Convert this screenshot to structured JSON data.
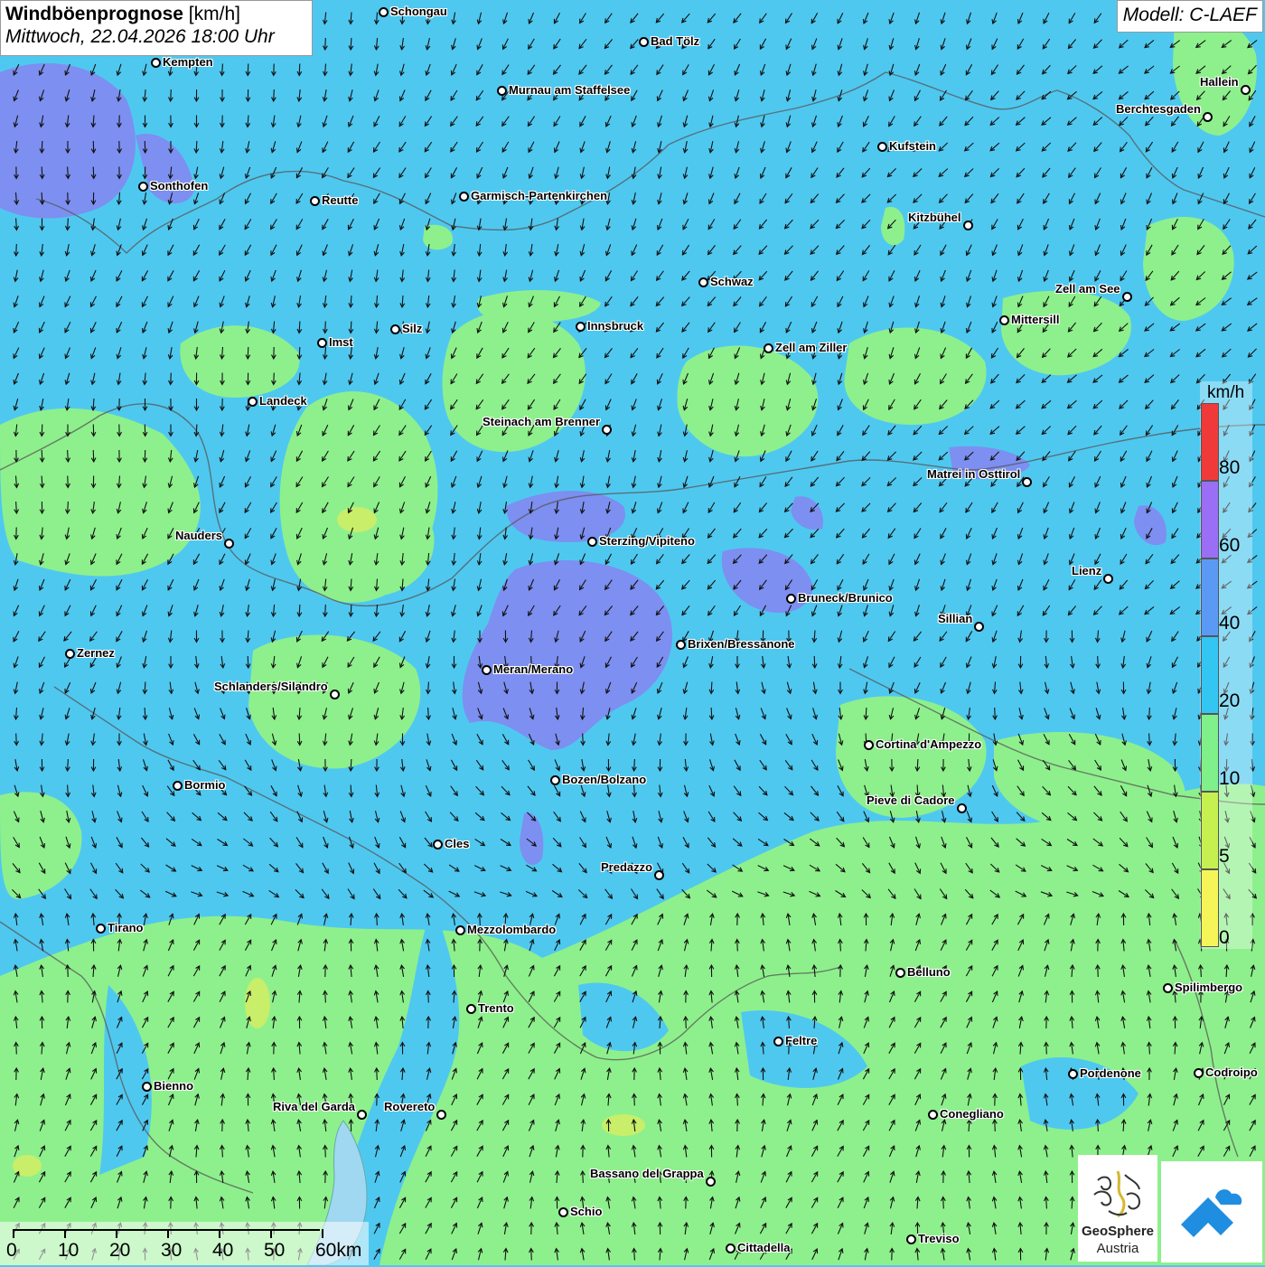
{
  "header": {
    "title_bold": "Windböenprognose",
    "title_unit": " [km/h]",
    "datetime": "Mittwoch, 22.04.2026 18:00 Uhr",
    "model": "Modell: C-LAEF"
  },
  "legend": {
    "unit": "km/h",
    "labels": [
      "80",
      "60",
      "40",
      "20",
      "10",
      "5",
      "0"
    ],
    "colors": [
      "#f03a3a",
      "#9a6ef5",
      "#5a9af5",
      "#33c6f3",
      "#7ff08a",
      "#c6f050",
      "#f5f55a"
    ]
  },
  "scalebar": {
    "labels": [
      "0",
      "10",
      "20",
      "30",
      "40",
      "50",
      "60km"
    ]
  },
  "logo": {
    "name_line1": "GeoSphere",
    "name_line2": "Austria"
  },
  "map_colors": {
    "base": "#4fc8f0",
    "green": "#8ef08c",
    "purple": "#7d8ff0",
    "yellow": "#c8ee6a"
  },
  "cities": [
    {
      "name": "Schongau",
      "side": "right"
    },
    {
      "name": "Bad Tölz",
      "side": "right"
    },
    {
      "name": "Kempten",
      "side": "right"
    },
    {
      "name": "Murnau am Staffelsee",
      "side": "right"
    },
    {
      "name": "Hallein",
      "side": "left"
    },
    {
      "name": "Berchtesgaden",
      "side": "left"
    },
    {
      "name": "Kufstein",
      "side": "right"
    },
    {
      "name": "Sonthofen",
      "side": "right"
    },
    {
      "name": "Reutte",
      "side": "right"
    },
    {
      "name": "Garmisch-Partenkirchen",
      "side": "right"
    },
    {
      "name": "Kitzbühel",
      "side": "left"
    },
    {
      "name": "Schwaz",
      "side": "right"
    },
    {
      "name": "Zell am See",
      "side": "left"
    },
    {
      "name": "Mittersill",
      "side": "right"
    },
    {
      "name": "Innsbruck",
      "side": "right"
    },
    {
      "name": "Silz",
      "side": "right"
    },
    {
      "name": "Imst",
      "side": "right"
    },
    {
      "name": "Zell am Ziller",
      "side": "right"
    },
    {
      "name": "Landeck",
      "side": "right"
    },
    {
      "name": "Steinach am Brenner",
      "side": "left"
    },
    {
      "name": "Matrei in Osttirol",
      "side": "left"
    },
    {
      "name": "Nauders",
      "side": "left"
    },
    {
      "name": "Sterzing/Vipiteno",
      "side": "right"
    },
    {
      "name": "Lienz",
      "side": "left"
    },
    {
      "name": "Bruneck/Brunico",
      "side": "right"
    },
    {
      "name": "Sillian",
      "side": "left"
    },
    {
      "name": "Brixen/Bressanone",
      "side": "right"
    },
    {
      "name": "Zernez",
      "side": "right"
    },
    {
      "name": "Meran/Merano",
      "side": "right"
    },
    {
      "name": "Schlanders/Silandro",
      "side": "left"
    },
    {
      "name": "Cortina d'Ampezzo",
      "side": "right"
    },
    {
      "name": "Bozen/Bolzano",
      "side": "right"
    },
    {
      "name": "Bormio",
      "side": "right"
    },
    {
      "name": "Pieve di Cadore",
      "side": "left"
    },
    {
      "name": "Cles",
      "side": "right"
    },
    {
      "name": "Predazzo",
      "side": "left"
    },
    {
      "name": "Tirano",
      "side": "right"
    },
    {
      "name": "Mezzolombardo",
      "side": "right"
    },
    {
      "name": "Belluno",
      "side": "right"
    },
    {
      "name": "Spilimbergo",
      "side": "right"
    },
    {
      "name": "Trento",
      "side": "right"
    },
    {
      "name": "Feltre",
      "side": "right"
    },
    {
      "name": "Pordenone",
      "side": "right"
    },
    {
      "name": "Codroipo",
      "side": "right"
    },
    {
      "name": "Bienno",
      "side": "right"
    },
    {
      "name": "Riva del Garda",
      "side": "left"
    },
    {
      "name": "Rovereto",
      "side": "left"
    },
    {
      "name": "Conegliano",
      "side": "right"
    },
    {
      "name": "Bassano del Grappa",
      "side": "left"
    },
    {
      "name": "Schio",
      "side": "right"
    },
    {
      "name": "Treviso",
      "side": "right"
    },
    {
      "name": "Cittadella",
      "side": "right"
    }
  ]
}
